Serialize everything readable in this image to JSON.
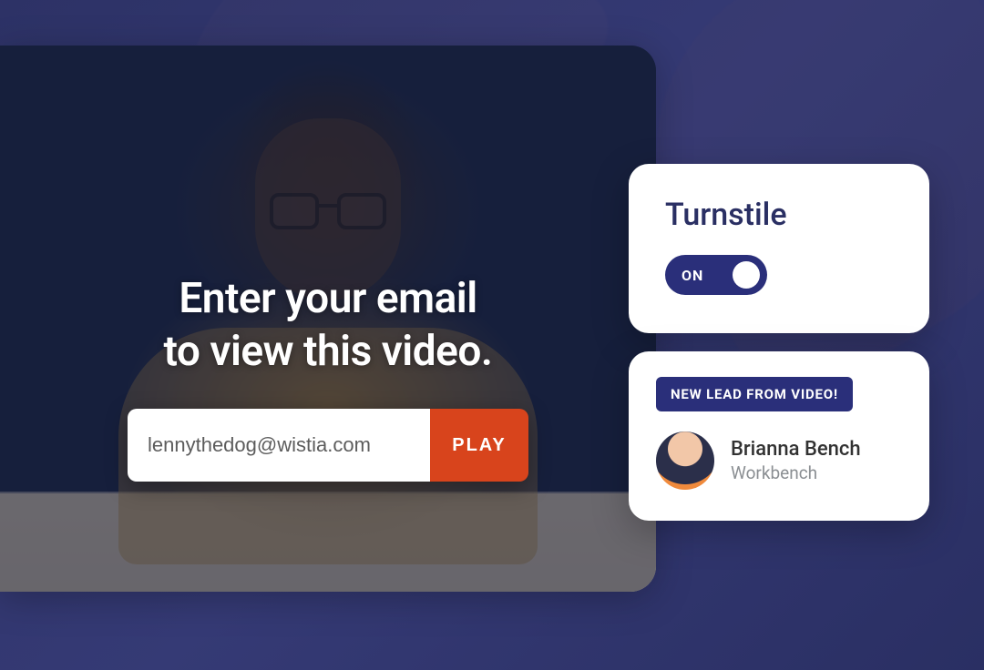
{
  "overlay": {
    "heading_line1": "Enter your email",
    "heading_line2": "to view this video.",
    "email_value": "lennythedog@wistia.com",
    "play_label": "PLAY"
  },
  "turnstile": {
    "title": "Turnstile",
    "toggle_state": "ON"
  },
  "lead": {
    "badge": "NEW LEAD FROM VIDEO!",
    "name": "Brianna Bench",
    "company": "Workbench"
  }
}
